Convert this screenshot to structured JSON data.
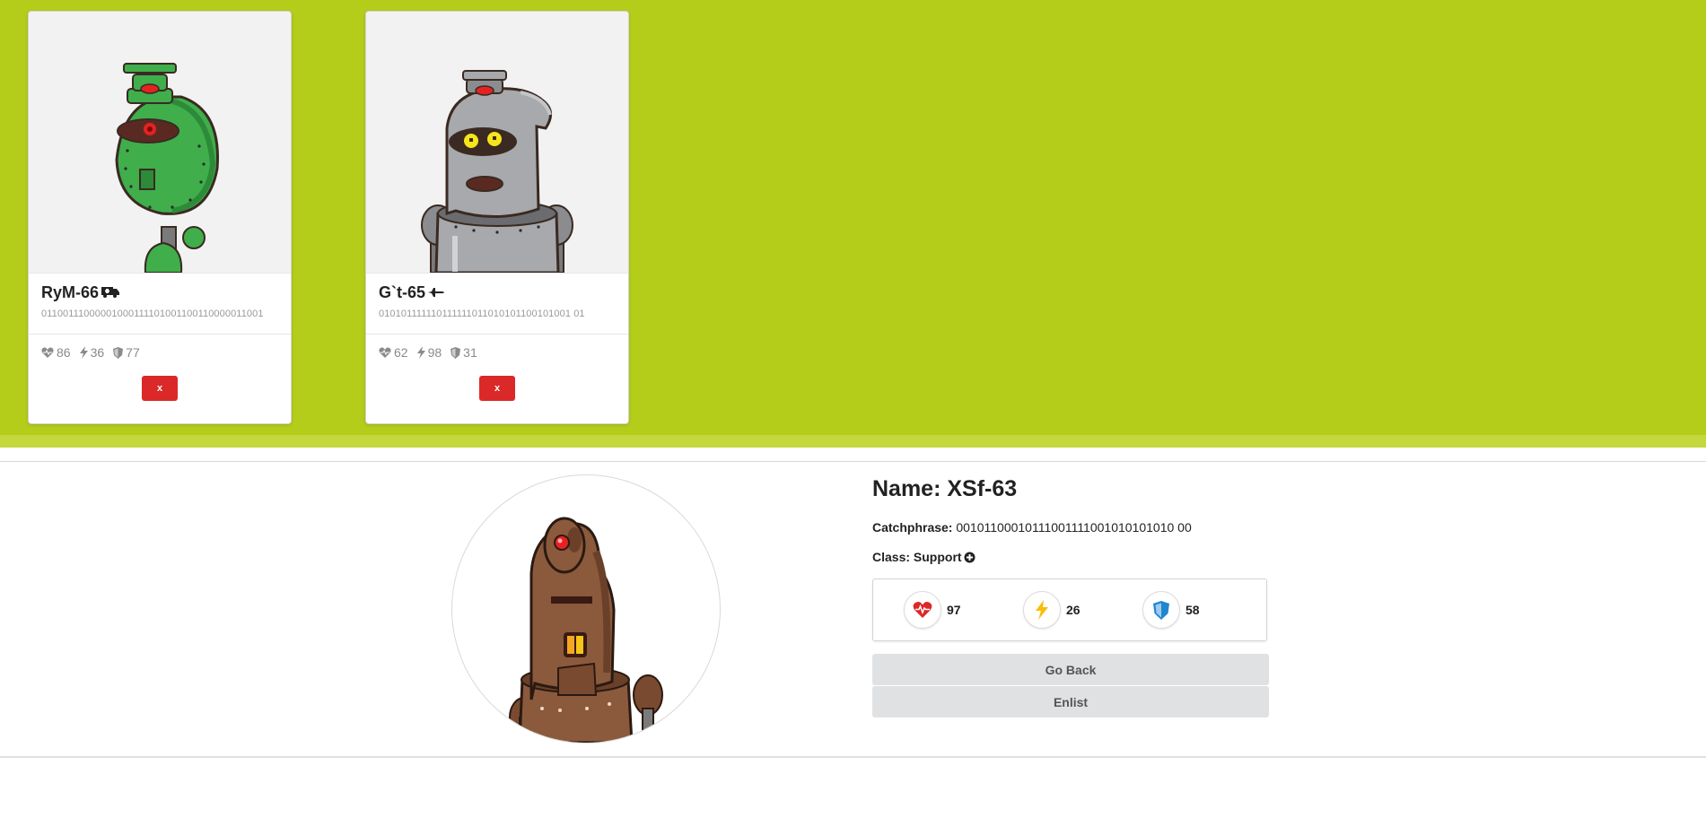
{
  "army": [
    {
      "name": "RyM-66",
      "class_icon": "ambulance-icon",
      "code": "01100111000001000111101001100110000011001",
      "stats": {
        "health": "86",
        "attack": "36",
        "defense": "77"
      },
      "remove_label": "x",
      "body_color": "#3fae4b"
    },
    {
      "name": "G`t-65",
      "class_icon": "plane-icon",
      "code": "010101111110111111011010101100101001 01",
      "stats": {
        "health": "62",
        "attack": "98",
        "defense": "31"
      },
      "remove_label": "x",
      "body_color": "#a7a9ac"
    }
  ],
  "detail": {
    "name": "Name: XSf-63",
    "catchphrase_label": "Catchphrase:",
    "catchphrase": "00101100010111001111001010101010 00",
    "class_label": "Class: Support",
    "class_icon": "plus-circle-icon",
    "stats": {
      "health": "97",
      "attack": "26",
      "defense": "58"
    },
    "go_back_label": "Go Back",
    "enlist_label": "Enlist",
    "body_color": "#8b5a3c"
  },
  "colors": {
    "banner": "#b4cd1b",
    "remove_button": "#db2828",
    "health": "#db2828",
    "attack": "#fbbd08",
    "defense": "#2185d0"
  }
}
